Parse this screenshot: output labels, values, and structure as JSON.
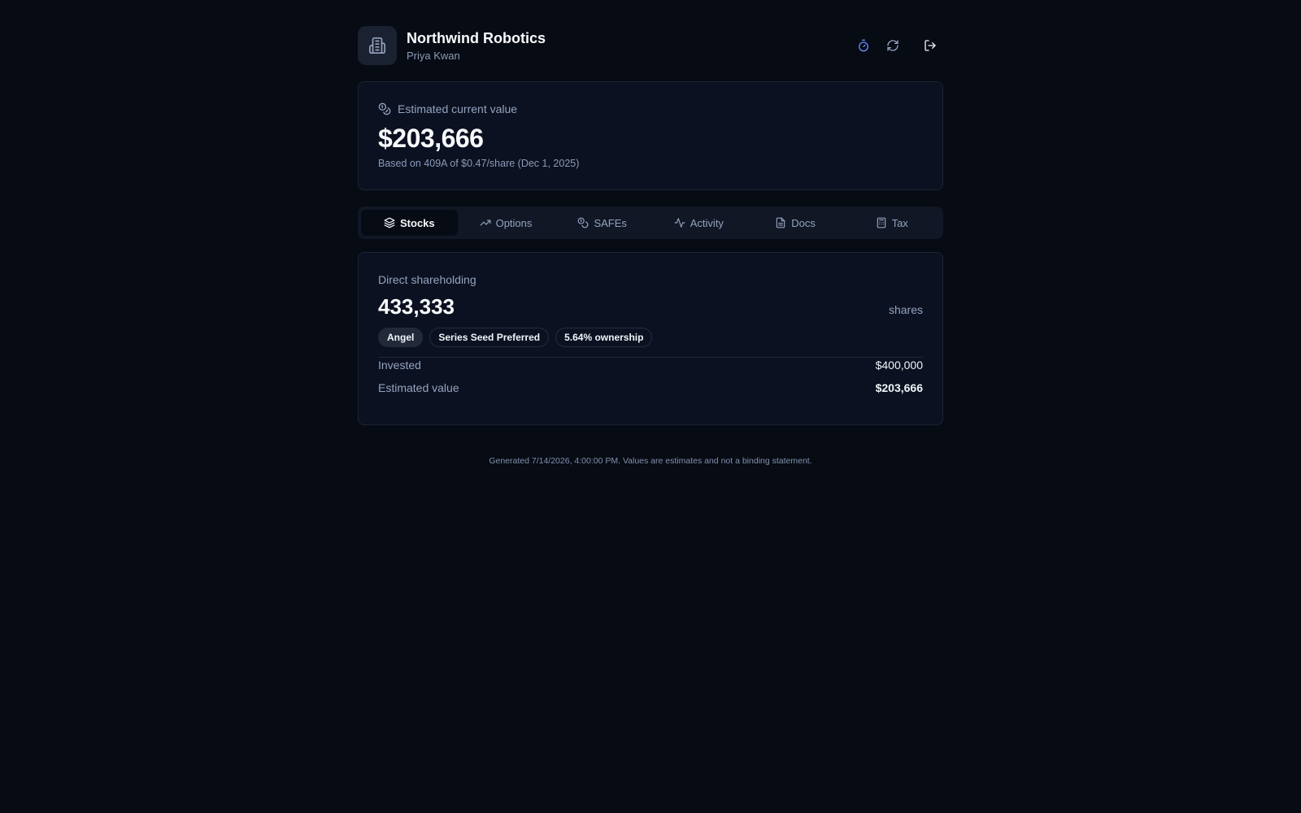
{
  "header": {
    "company": "Northwind Robotics",
    "user": "Priya Kwan",
    "icons": {
      "logo": "building-icon",
      "timer": "stopwatch-icon",
      "refresh": "refresh-icon",
      "logout": "logout-icon"
    }
  },
  "value_card": {
    "label": "Estimated current value",
    "amount": "$203,666",
    "subtitle": "Based on 409A of $0.47/share (Dec 1, 2025)",
    "icon": "coins-icon"
  },
  "tabs": [
    {
      "label": "Stocks",
      "icon": "layers-icon",
      "active": true
    },
    {
      "label": "Options",
      "icon": "trending-up-icon",
      "active": false
    },
    {
      "label": "SAFEs",
      "icon": "coins-icon",
      "active": false
    },
    {
      "label": "Activity",
      "icon": "activity-icon",
      "active": false
    },
    {
      "label": "Docs",
      "icon": "document-icon",
      "active": false
    },
    {
      "label": "Tax",
      "icon": "calculator-icon",
      "active": false
    }
  ],
  "shares": {
    "label": "Direct shareholding",
    "amount": "433,333",
    "unit": "shares",
    "badges": [
      "Angel",
      "Series Seed Preferred",
      "5.64% ownership"
    ],
    "invested_label": "Invested",
    "invested_value": "$400,000",
    "estimated_label": "Estimated value",
    "estimated_value": "$203,666"
  },
  "footer": "Generated 7/14/2026, 4:00:00 PM. Values are estimates and not a binding statement.",
  "colors": {
    "background": "#070b14",
    "card": "#0b1120",
    "accent": "#6b8cff"
  }
}
